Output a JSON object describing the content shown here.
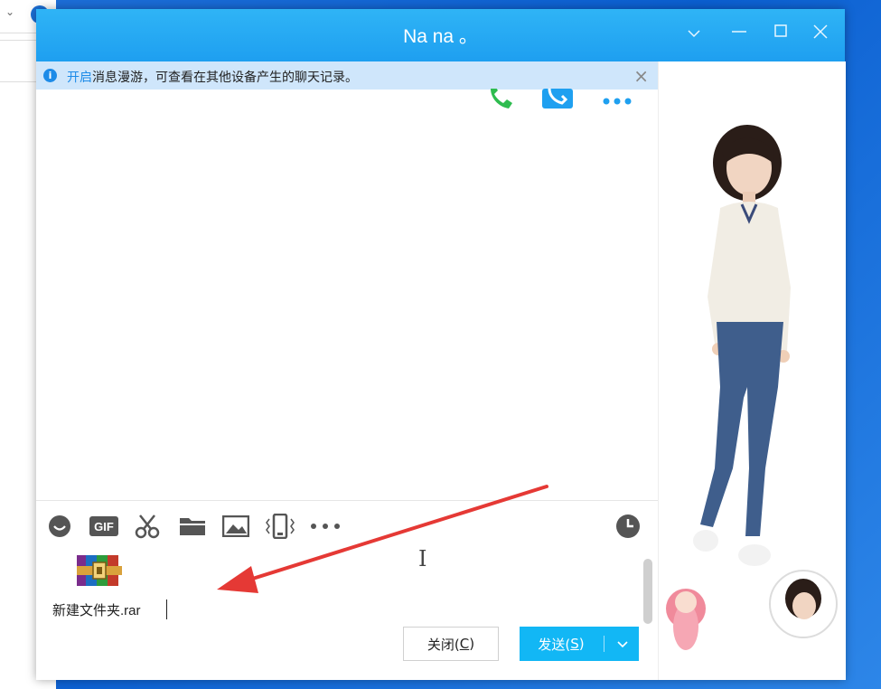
{
  "window": {
    "title": "Na  na 。",
    "controls": [
      "chevron-down-icon",
      "minimize-icon",
      "maximize-icon",
      "close-icon"
    ]
  },
  "notice": {
    "link": "开启",
    "text": "消息漫游，可查看在其他设备产生的聊天记录。"
  },
  "toolbar": {
    "items": [
      "emoji-icon",
      "gif-icon",
      "scissors-icon",
      "folder-icon",
      "image-icon",
      "shake-icon",
      "more-icon",
      "history-icon"
    ],
    "gif_label": "GIF"
  },
  "input": {
    "attachment_name": "新建文件夹.rar"
  },
  "buttons": {
    "close_text": "关闭(",
    "close_key": "C",
    "close_end": ")",
    "send_text": "发送(",
    "send_key": "S",
    "send_end": ")"
  },
  "colors": {
    "titlebar": "#1e9ff0",
    "send_button": "#12b7f5",
    "notice_bg": "#cfe6fb",
    "arrow": "#e53935"
  }
}
